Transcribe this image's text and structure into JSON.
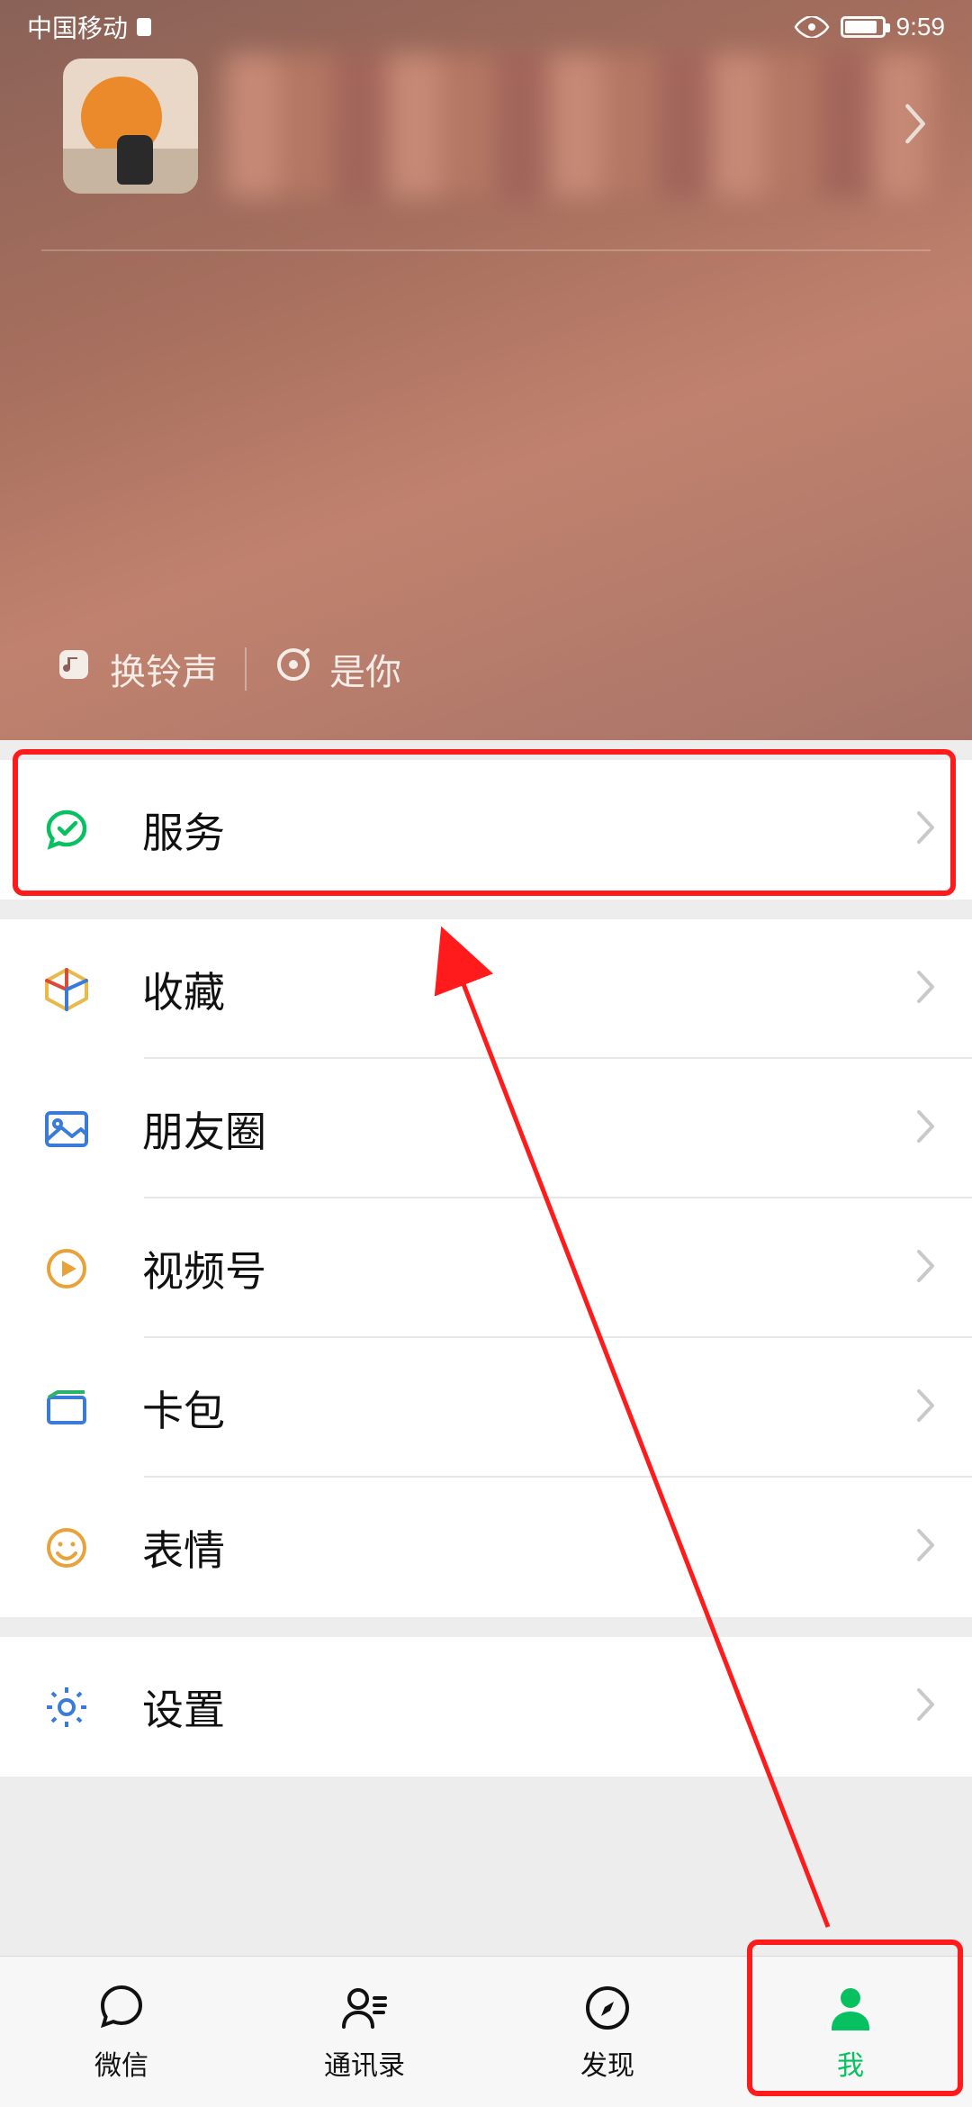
{
  "statusbar": {
    "carrier": "中国移动",
    "time": "9:59"
  },
  "hero": {
    "ringtone_label": "换铃声",
    "song_label": "是你"
  },
  "menu": {
    "services": "服务",
    "favorites": "收藏",
    "moments": "朋友圈",
    "channels": "视频号",
    "cards": "卡包",
    "stickers": "表情",
    "settings": "设置"
  },
  "tabs": {
    "chats": "微信",
    "contacts": "通讯录",
    "discover": "发现",
    "me": "我"
  },
  "colors": {
    "accent": "#07c160",
    "annotation": "#ff1b1b"
  }
}
